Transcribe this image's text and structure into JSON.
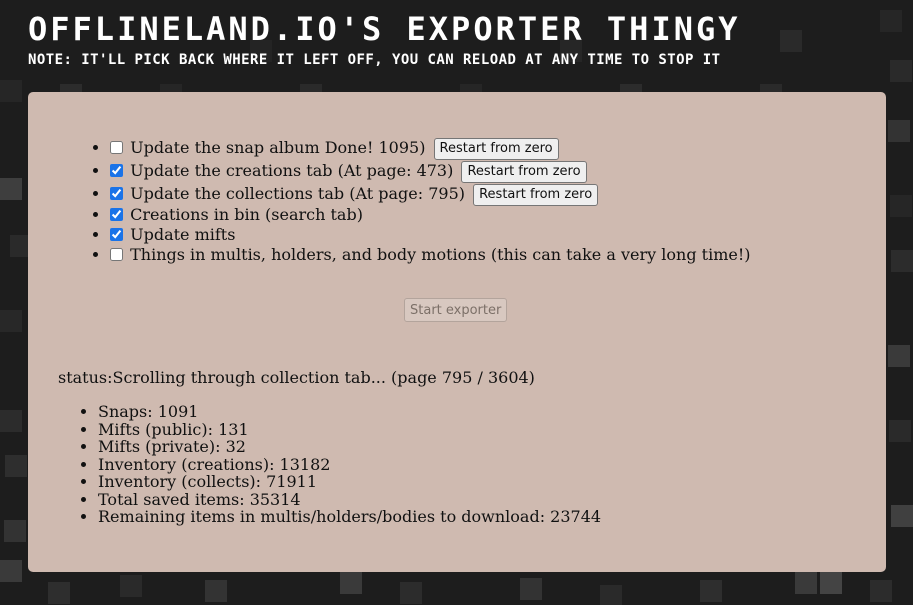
{
  "header": {
    "title": "OFFLINELAND.IO'S EXPORTER THINGY",
    "note": "NOTE: IT'LL PICK BACK WHERE IT LEFT OFF, YOU CAN RELOAD AT ANY TIME TO STOP IT"
  },
  "options": [
    {
      "label": "Update the snap album Done! 1095)",
      "checked": false,
      "button": "Restart from zero"
    },
    {
      "label": "Update the creations tab (At page: 473)",
      "checked": true,
      "button": "Restart from zero"
    },
    {
      "label": "Update the collections tab (At page: 795)",
      "checked": true,
      "button": "Restart from zero"
    },
    {
      "label": "Creations in bin (search tab)",
      "checked": true
    },
    {
      "label": "Update mifts",
      "checked": true
    },
    {
      "label": "Things in multis, holders, and body motions (this can take a very long time!)",
      "checked": false
    }
  ],
  "start_button": "Start exporter",
  "status": "status:Scrolling through collection tab... (page 795 / 3604)",
  "stats": [
    "Snaps: 1091",
    "Mifts (public): 131",
    "Mifts (private): 32",
    "Inventory (creations): 13182",
    "Inventory (collects): 71911",
    "Total saved items: 35314",
    "Remaining items in multis/holders/bodies to download: 23744"
  ],
  "colors": {
    "background": "#1d1d1d",
    "panel": "#cfbab0",
    "checkbox_accent": "#1a73e8"
  }
}
